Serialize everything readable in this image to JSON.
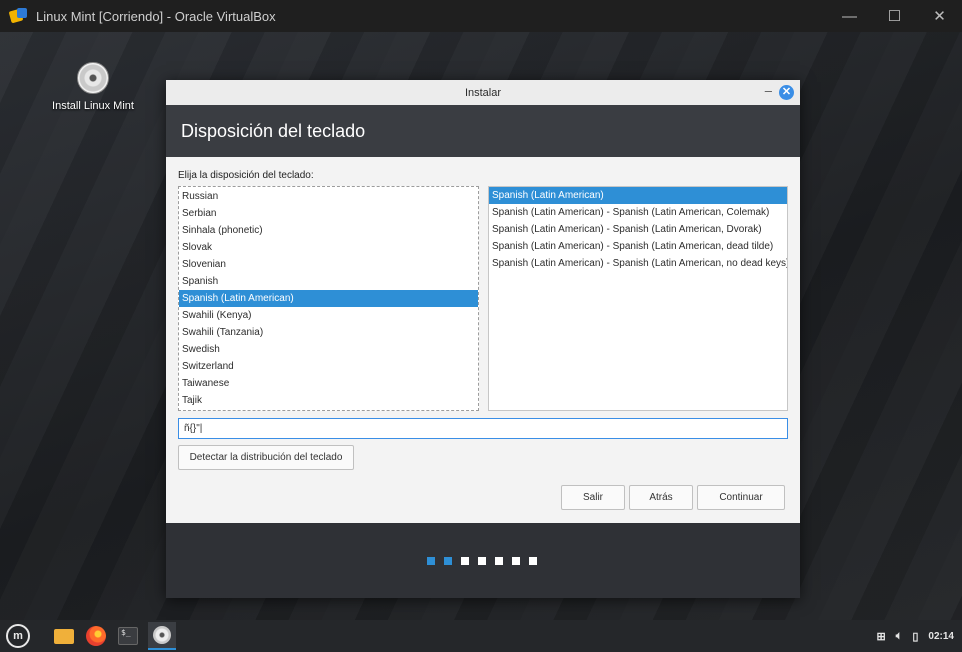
{
  "vbox": {
    "title": "Linux Mint [Corriendo] - Oracle VirtualBox",
    "minimize": "—",
    "maximize": "☐",
    "close": "✕"
  },
  "desktop": {
    "icon_label": "Install Linux Mint"
  },
  "installer": {
    "window_title": "Instalar",
    "minimize": "–",
    "close": "✕",
    "header": "Disposición del teclado",
    "prompt": "Elija la disposición del teclado:",
    "layouts": [
      "Russian",
      "Serbian",
      "Sinhala (phonetic)",
      "Slovak",
      "Slovenian",
      "Spanish",
      "Spanish (Latin American)",
      "Swahili (Kenya)",
      "Swahili (Tanzania)",
      "Swedish",
      "Switzerland",
      "Taiwanese",
      "Tajik"
    ],
    "selected_layout": "Spanish (Latin American)",
    "variants": [
      "Spanish (Latin American)",
      "Spanish (Latin American) - Spanish (Latin American, Colemak)",
      "Spanish (Latin American) - Spanish (Latin American, Dvorak)",
      "Spanish (Latin American) - Spanish (Latin American, dead tilde)",
      "Spanish (Latin American) - Spanish (Latin American, no dead keys)"
    ],
    "selected_variant": "Spanish (Latin American)",
    "test_input_value": "ñ{}\"|",
    "detect_button": "Detectar la distribución del teclado",
    "quit_button": "Salir",
    "back_button": "Atrás",
    "continue_button": "Continuar",
    "progress": {
      "total_steps": 7,
      "completed_steps": 2
    }
  },
  "taskbar": {
    "menu_icon": "linux-mint-menu-icon",
    "apps": [
      "file-manager-icon",
      "firefox-icon",
      "terminal-icon",
      "install-disc-icon"
    ],
    "tray_icons": [
      "network-icon",
      "volume-icon",
      "battery-icon"
    ],
    "clock": "02:14"
  },
  "colors": {
    "accent": "#2e8fd6",
    "selection": "#2e8fd6",
    "header_bg": "#3a3d42"
  }
}
